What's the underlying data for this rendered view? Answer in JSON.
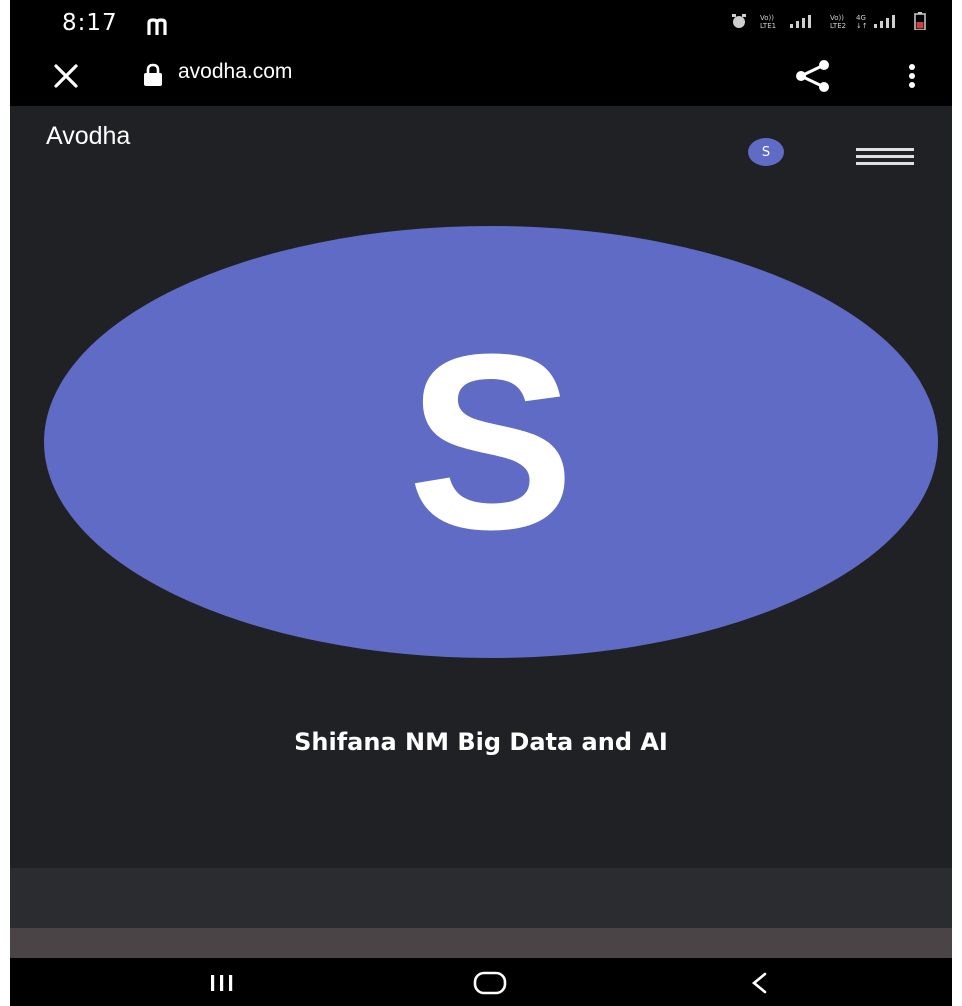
{
  "status_bar": {
    "time": "8:17",
    "notification_icon": "m-letter-icon",
    "right_indicators": [
      "alarm-icon",
      "volte-lte1-signal-icon",
      "volte-lte2-4g-signal-icon",
      "battery-icon"
    ]
  },
  "browser": {
    "url": "avodha.com",
    "close_icon": "close-icon",
    "lock_icon": "lock-icon",
    "share_icon": "share-icon",
    "menu_icon": "vertical-dots-icon"
  },
  "site": {
    "brand": "Avodha",
    "mini_avatar_letter": "S",
    "hamburger_icon": "hamburger-icon"
  },
  "profile": {
    "avatar_letter": "S",
    "caption": "Shifana NM Big Data and AI"
  },
  "colors": {
    "background": "#202124",
    "avatar": "#5f6bc4",
    "topbar": "#000000"
  },
  "nav_bar": {
    "recents_icon": "recents-icon",
    "home_icon": "home-icon",
    "back_icon": "back-icon"
  }
}
